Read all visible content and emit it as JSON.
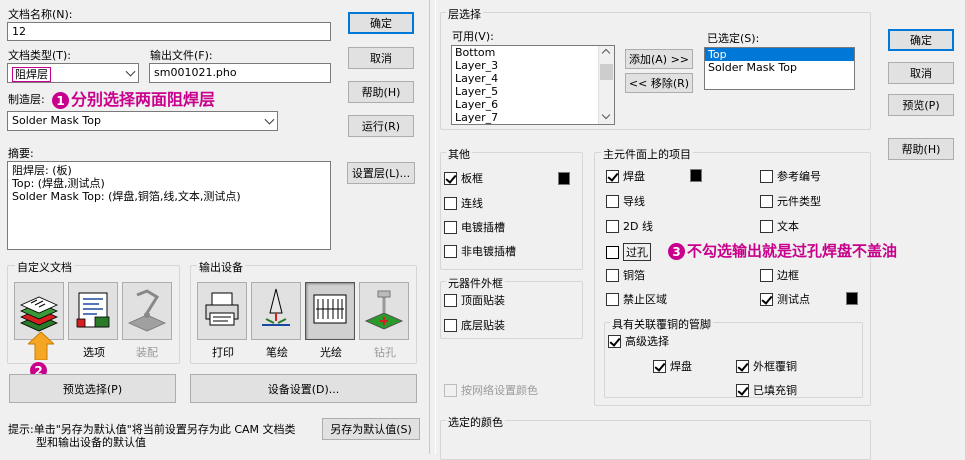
{
  "left": {
    "doc_name_label": "文档名称(N):",
    "doc_name_value": "12",
    "doc_type_label": "文档类型(T):",
    "doc_type_value": "阻焊层",
    "output_file_label": "输出文件(F):",
    "output_file_value": "sm001021.pho",
    "fab_layer_label": "制造层:",
    "fab_layer_value": "Solder Mask Top",
    "annotation_1_num": "1",
    "annotation_1_text": "分别选择两面阻焊层",
    "summary_label": "摘要:",
    "summary_lines": [
      "阻焊层: (板)",
      "Top: (焊盘,测试点)",
      "Solder Mask Top: (焊盘,铜箔,线,文本,测试点)"
    ],
    "buttons": {
      "ok": "确定",
      "cancel": "取消",
      "help": "帮助(H)",
      "run": "运行(R)",
      "layers": "设置层(L)...",
      "preview_select": "预览选择(P)",
      "device_setup": "设备设置(D)...",
      "save_default": "另存为默认值(S)"
    },
    "custom_doc_title": "自定义文档",
    "output_device_title": "输出设备",
    "custom_doc_items": [
      {
        "label": ""
      },
      {
        "label": "选项"
      },
      {
        "label": "装配"
      }
    ],
    "output_device_items": [
      {
        "label": "打印"
      },
      {
        "label": "笔绘"
      },
      {
        "label": "光绘"
      },
      {
        "label": "钻孔"
      }
    ],
    "annotation_2_num": "2",
    "hint_line1": "提示:单击\"另存为默认值\"将当前设置另存为此 CAM 文档类",
    "hint_line2": "型和输出设备的默认值"
  },
  "right": {
    "layer_select_title": "层选择",
    "available_label": "可用(V):",
    "available_items": [
      "Bottom",
      "Layer_3",
      "Layer_4",
      "Layer_5",
      "Layer_6",
      "Layer_7"
    ],
    "selected_label": "已选定(S):",
    "selected_items": [
      "Top",
      "Solder Mask Top"
    ],
    "add_button": "添加(A) >>",
    "remove_button": "<< 移除(R)",
    "buttons": {
      "ok": "确定",
      "cancel": "取消",
      "preview": "预览(P)",
      "help": "帮助(H)"
    },
    "other_title": "其他",
    "other_items": [
      {
        "label": "板框",
        "checked": true
      },
      {
        "label": "连线",
        "checked": false
      },
      {
        "label": "电镀插槽",
        "checked": false
      },
      {
        "label": "非电镀插槽",
        "checked": false
      }
    ],
    "outline_title": "元器件外框",
    "outline_items": [
      {
        "label": "顶面贴装",
        "checked": false
      },
      {
        "label": "底层贴装",
        "checked": false
      }
    ],
    "net_color_label": "按网络设置颜色",
    "main_title": "主元件面上的项目",
    "main_col1": [
      {
        "label": "焊盘",
        "checked": true
      },
      {
        "label": "导线",
        "checked": false
      },
      {
        "label": "2D 线",
        "checked": false
      },
      {
        "label": "过孔",
        "checked": false
      },
      {
        "label": "铜箔",
        "checked": false
      },
      {
        "label": "禁止区域",
        "checked": false
      }
    ],
    "main_col2": [
      {
        "label": "参考编号",
        "checked": false
      },
      {
        "label": "元件类型",
        "checked": false
      },
      {
        "label": "文本",
        "checked": false
      },
      {
        "label": "",
        "checked": false
      },
      {
        "label": "边框",
        "checked": false
      },
      {
        "label": "测试点",
        "checked": true
      }
    ],
    "annotation_3_num": "3",
    "annotation_3_text": "不勾选输出就是过孔焊盘不盖油",
    "linked_title": "具有关联覆铜的管脚",
    "advanced_label": "高级选择",
    "advanced_checked": true,
    "linked_items": [
      {
        "label": "焊盘",
        "checked": true
      },
      {
        "label": "外框覆铜",
        "checked": true
      },
      {
        "label": "已填充铜",
        "checked": true
      }
    ],
    "selected_color_title": "选定的颜色"
  }
}
